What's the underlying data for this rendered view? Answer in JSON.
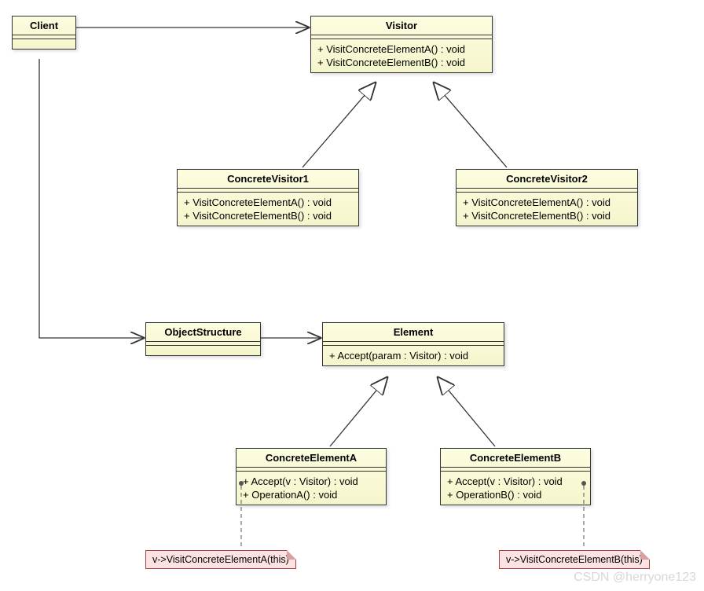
{
  "classes": {
    "client": {
      "name": "Client"
    },
    "visitor": {
      "name": "Visitor",
      "ops": [
        "+ VisitConcreteElementA() : void",
        "+ VisitConcreteElementB() : void"
      ]
    },
    "cv1": {
      "name": "ConcreteVisitor1",
      "ops": [
        "+ VisitConcreteElementA() : void",
        "+ VisitConcreteElementB() : void"
      ]
    },
    "cv2": {
      "name": "ConcreteVisitor2",
      "ops": [
        "+ VisitConcreteElementA() : void",
        "+ VisitConcreteElementB() : void"
      ]
    },
    "objstruct": {
      "name": "ObjectStructure"
    },
    "element": {
      "name": "Element",
      "ops": [
        "+ Accept(param : Visitor) : void"
      ]
    },
    "cea": {
      "name": "ConcreteElementA",
      "ops": [
        "+ Accept(v : Visitor) : void",
        "+ OperationA() : void"
      ]
    },
    "ceb": {
      "name": "ConcreteElementB",
      "ops": [
        "+ Accept(v : Visitor) : void",
        "+ OperationB() : void"
      ]
    }
  },
  "notes": {
    "noteA": "v->VisitConcreteElementA(this)",
    "noteB": "v->VisitConcreteElementB(this)"
  },
  "watermark": "CSDN @herryone123"
}
